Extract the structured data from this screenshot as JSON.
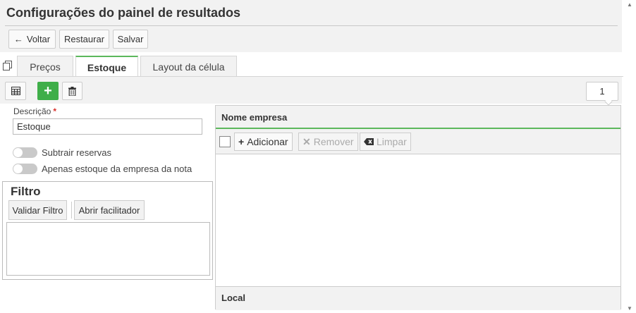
{
  "header": {
    "title": "Configurações do painel de resultados",
    "buttons": {
      "back_icon": "arrow-left-icon",
      "back_label": "Voltar",
      "restore_label": "Restaurar",
      "save_label": "Salvar"
    }
  },
  "tabs": {
    "copy_icon": "copy-icon",
    "items": [
      {
        "label": "Preços",
        "active": false
      },
      {
        "label": "Estoque",
        "active": true
      },
      {
        "label": "Layout da célula",
        "active": false
      }
    ]
  },
  "toolbar": {
    "table_icon": "table-icon",
    "add_icon": "plus-icon",
    "delete_icon": "trash-icon",
    "counter_value": "1",
    "accent_color": "#3fae49"
  },
  "form": {
    "description_label": "Descrição",
    "required_marker": "*",
    "description_value": "Estoque",
    "toggles": [
      {
        "label": "Subtrair reservas",
        "on": false
      },
      {
        "label": "Apenas estoque da empresa da nota",
        "on": false
      }
    ]
  },
  "filter": {
    "title": "Filtro",
    "validate_label": "Validar Filtro",
    "helper_label": "Abrir facilitador",
    "text_value": ""
  },
  "company_panel": {
    "header_label": "Nome empresa",
    "add_label": "Adicionar",
    "remove_label": "Remover",
    "clear_label": "Limpar",
    "footer_label": "Local",
    "header_accent": "#5cb85c"
  }
}
